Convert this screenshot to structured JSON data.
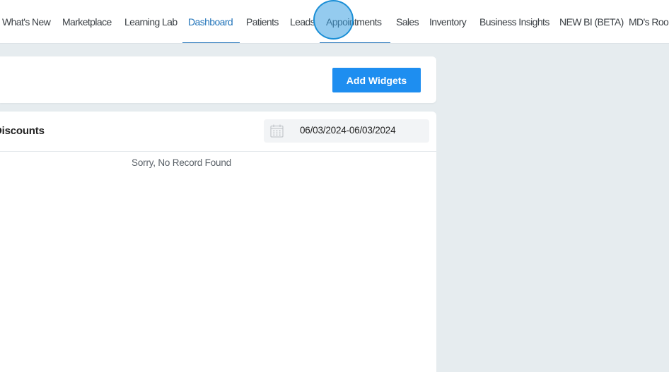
{
  "nav": {
    "items": [
      {
        "label": "What's New"
      },
      {
        "label": "Marketplace"
      },
      {
        "label": "Learning Lab"
      },
      {
        "label": "Dashboard",
        "active": true
      },
      {
        "label": "Patients"
      },
      {
        "label": "Leads"
      },
      {
        "label": "Appointments"
      },
      {
        "label": "Sales"
      },
      {
        "label": "Inventory"
      },
      {
        "label": "Business Insights"
      },
      {
        "label": "NEW BI (BETA)"
      },
      {
        "label": "MD's Room"
      }
    ]
  },
  "toolbar": {
    "add_widgets_label": "Add Widgets"
  },
  "widget": {
    "title": "Discounts",
    "date_range": "06/03/2024-06/03/2024",
    "empty_message": "Sorry, No Record Found"
  },
  "colors": {
    "accent": "#1f72b8",
    "button": "#1e8ef0",
    "background": "#e6ecef"
  }
}
